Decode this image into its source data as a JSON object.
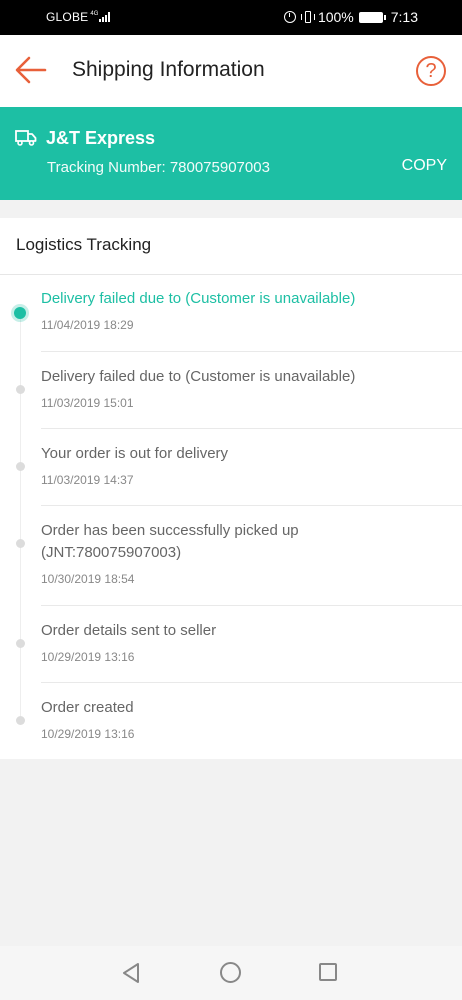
{
  "status_bar": {
    "carrier": "GLOBE",
    "network": "4G",
    "battery": "100%",
    "time": "7:13"
  },
  "header": {
    "title": "Shipping Information",
    "help_label": "?"
  },
  "courier": {
    "name": "J&T Express",
    "tracking_text": "Tracking Number: 780075907003",
    "copy_label": "COPY"
  },
  "logistics": {
    "section_title": "Logistics Tracking",
    "events": [
      {
        "title": "Delivery failed due to (Customer is unavailable)",
        "time": "11/04/2019 18:29",
        "active": true
      },
      {
        "title": "Delivery failed due to (Customer is unavailable)",
        "time": "11/03/2019 15:01",
        "active": false
      },
      {
        "title": "Your order is out for delivery",
        "time": "11/03/2019 14:37",
        "active": false
      },
      {
        "title": "Order has been successfully picked up (JNT:780075907003)",
        "time": "10/30/2019 18:54",
        "active": false
      },
      {
        "title": "Order details sent to seller",
        "time": "10/29/2019 13:16",
        "active": false
      },
      {
        "title": "Order created",
        "time": "10/29/2019 13:16",
        "active": false
      }
    ]
  },
  "colors": {
    "accent": "#1dbfa4",
    "header_icon": "#e8603a"
  },
  "nav_icons": [
    "back-triangle-icon",
    "home-circle-icon",
    "recents-square-icon"
  ]
}
